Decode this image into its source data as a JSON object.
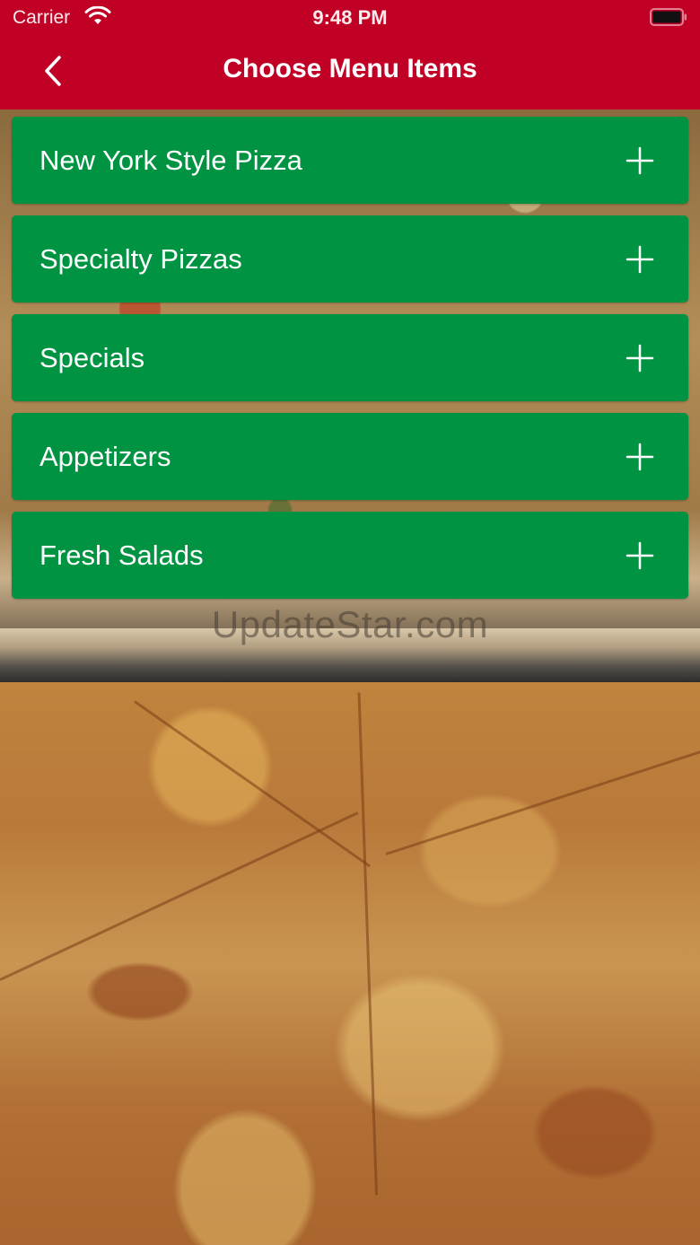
{
  "status_bar": {
    "carrier": "Carrier",
    "time": "9:48 PM"
  },
  "nav": {
    "title": "Choose Menu Items",
    "back_icon": "chevron-left-icon"
  },
  "menu": {
    "items": [
      {
        "label": "New York Style Pizza",
        "icon": "plus-icon"
      },
      {
        "label": "Specialty Pizzas",
        "icon": "plus-icon"
      },
      {
        "label": "Specials",
        "icon": "plus-icon"
      },
      {
        "label": "Appetizers",
        "icon": "plus-icon"
      },
      {
        "label": "Fresh Salads",
        "icon": "plus-icon"
      }
    ]
  },
  "watermark": "UpdateStar.com",
  "colors": {
    "header_red": "#c00024",
    "item_green": "#009442",
    "text_white": "#ffffff"
  }
}
